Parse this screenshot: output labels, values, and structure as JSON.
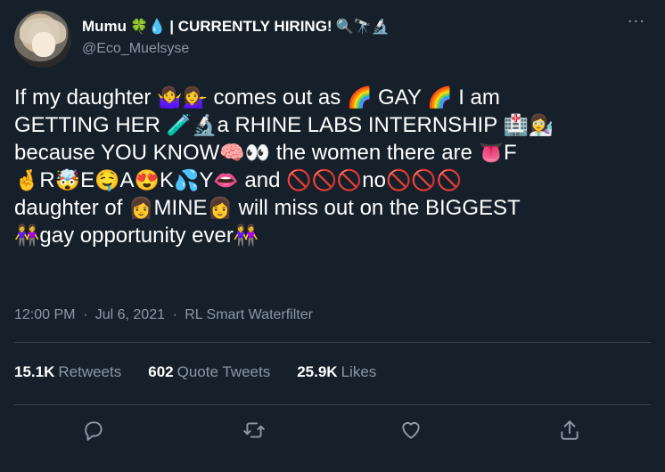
{
  "author": {
    "display_name": "Mumu",
    "name_suffix": "| CURRENTLY HIRING!",
    "name_emojis_before": "🍀💧",
    "name_emojis_after": "🔍🔭🔬",
    "handle": "@Eco_Muelsyse"
  },
  "more_icon": "···",
  "tweet": {
    "lines": [
      [
        {
          "t": "If my daughter "
        },
        {
          "e": "🤷‍♀️💁‍♀️"
        },
        {
          "t": " comes out as "
        },
        {
          "e": "🌈"
        },
        {
          "t": " GAY "
        },
        {
          "e": "🌈"
        },
        {
          "t": " I am"
        }
      ],
      [
        {
          "t": "GETTING HER "
        },
        {
          "e": "🧪🔬"
        },
        {
          "t": "a RHINE LABS INTERNSHIP "
        },
        {
          "e": "🏥👩‍🔬"
        }
      ],
      [
        {
          "t": "because YOU KNOW"
        },
        {
          "e": "🧠👀"
        },
        {
          "t": " the women there are "
        },
        {
          "e": "👅"
        },
        {
          "t": "F"
        }
      ],
      [
        {
          "e": "🤞"
        },
        {
          "t": "R"
        },
        {
          "e": "🤯"
        },
        {
          "t": "E"
        },
        {
          "e": "🤤"
        },
        {
          "t": "A"
        },
        {
          "e": "😍"
        },
        {
          "t": "K"
        },
        {
          "e": "💦"
        },
        {
          "t": "Y"
        },
        {
          "e": "👄"
        },
        {
          "t": " and "
        },
        {
          "e": "🚫🚫🚫"
        },
        {
          "t": "no"
        },
        {
          "e": "🚫🚫🚫"
        }
      ],
      [
        {
          "t": "daughter of "
        },
        {
          "e": "👩"
        },
        {
          "t": "MINE"
        },
        {
          "e": "👩"
        },
        {
          "t": " will miss out on the BIGGEST"
        }
      ],
      [
        {
          "e": "👭"
        },
        {
          "t": "gay opportunity ever"
        },
        {
          "e": "👭"
        }
      ]
    ]
  },
  "meta": {
    "time": "12:00 PM",
    "date": "Jul 6, 2021",
    "source": "RL Smart Waterfilter",
    "separator": "·"
  },
  "stats": {
    "retweets": {
      "count": "15.1K",
      "label": "Retweets"
    },
    "quotes": {
      "count": "602",
      "label": "Quote Tweets"
    },
    "likes": {
      "count": "25.9K",
      "label": "Likes"
    }
  },
  "colors": {
    "background": "#15202b",
    "text": "#ffffff",
    "muted": "#8b98a5",
    "divider": "#38444d"
  },
  "actions": [
    "reply-icon",
    "retweet-icon",
    "like-icon",
    "share-icon"
  ]
}
